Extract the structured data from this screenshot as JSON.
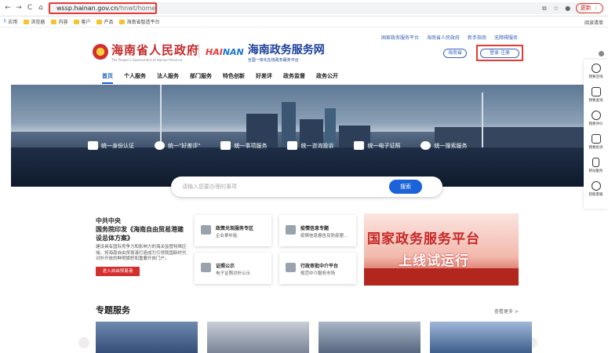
{
  "browser": {
    "url_host": "wssp.hainan.gov.cn",
    "url_path": "/hnwt/home",
    "update_label": "更新 ⋮"
  },
  "bookmarks": {
    "items": [
      "应用",
      "浏览器",
      "内容",
      "客户",
      "产品",
      "海南省智造平台"
    ],
    "reading_list": "阅读清单"
  },
  "header": {
    "top_links": [
      "国家政务服务平台",
      "海南省人民政府",
      "新手指南",
      "无障碍服务"
    ],
    "gov_title": "海南省人民政府",
    "gov_subtitle": "The People's Government of Hainan Province",
    "brand_hai": "HAI",
    "brand_nan": "NAN",
    "portal_title": "海南政务服务网",
    "portal_subtitle": "全国一体化在线政务服务平台",
    "region": "海南省",
    "login": "登录 注册"
  },
  "main_nav": [
    "首页",
    "个人服务",
    "法人服务",
    "部门服务",
    "特色创新",
    "好差评",
    "政务监督",
    "政务公开"
  ],
  "hero_items": [
    "统一身份认证",
    "统一\"好差评\"",
    "统一事项服务",
    "统一咨询投诉",
    "统一电子证照",
    "统一搜索服务"
  ],
  "search": {
    "placeholder": "请输入您要办理的事项",
    "button": "搜索"
  },
  "policy": {
    "line1": "中共中央",
    "line2": "国务院印发《海南自由贸易港建设总体方案》",
    "body": "建设具有国际竞争力和影响力的海关监管特殊区域，将海南自由贸易港打造成为引领我国新时代对外开放的鲜明旗帜和重要开放门户。",
    "cta": "进入自由贸易港"
  },
  "cards": [
    {
      "title": "政策兑现服务专区",
      "subtitle": "企业拿补贴"
    },
    {
      "title": "疫情信息专题",
      "subtitle": "疫情信息报告及防疫便..."
    },
    {
      "title": "证照公示",
      "subtitle": "电子证照对外公示"
    },
    {
      "title": "行政审批中介平台",
      "subtitle": "规范中介服务市场"
    }
  ],
  "banner": {
    "line1": "国家政务服务平台",
    "line2": "上线试运行"
  },
  "special": {
    "title": "专题服务",
    "more": "查看更多 >"
  },
  "sidebar": [
    "我要咨询",
    "我要查询",
    "我要评价",
    "我要投诉",
    "移动服务",
    "智能客服"
  ]
}
